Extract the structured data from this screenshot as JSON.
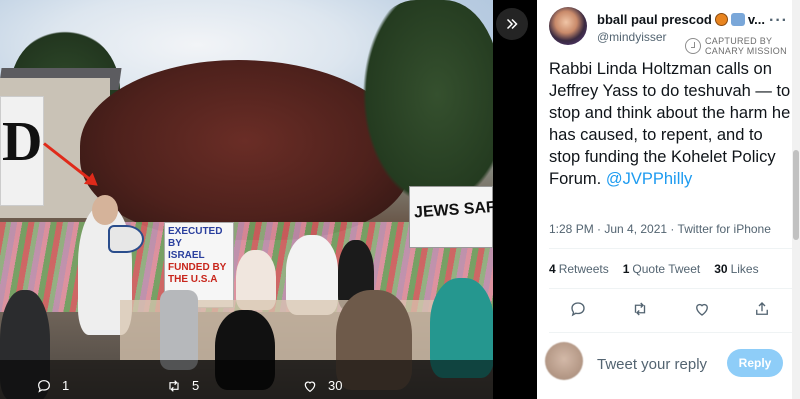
{
  "media_actions": {
    "reply_count": "1",
    "retweet_count": "5",
    "like_count": "30"
  },
  "photo": {
    "banner_left_text": "D",
    "jews_banner_text": "JEWS SAFREE P",
    "sign_lines": [
      "EXECUTED",
      "BY",
      "ISRAEL",
      "FUNDED BY",
      "THE U.S.A"
    ]
  },
  "tweet": {
    "display_name": "bball paul prescod",
    "display_name_suffix": "v...",
    "handle": "@mindyisser",
    "badge_line1": "CAPTURED BY",
    "badge_line2": "CANARY MISSION",
    "more_label": "···",
    "text_main": "Rabbi Linda Holtzman calls on Jeffrey Yass to do teshuvah — to stop and think about the harm he has caused, to repent, and to stop funding the Kohelet Policy Forum.",
    "text_mention": "@JVPPhilly",
    "timestamp": "1:28 PM · Jun 4, 2021 · Twitter for iPhone",
    "stats": {
      "retweets_count": "4",
      "retweets_label": "Retweets",
      "quotes_count": "1",
      "quotes_label": "Quote Tweet",
      "likes_count": "30",
      "likes_label": "Likes"
    },
    "reply_placeholder": "Tweet your reply",
    "reply_button": "Reply"
  },
  "colors": {
    "link": "#1d9bf0",
    "reply_button_bg": "#8ecdf8",
    "secondary_text": "#536471"
  }
}
